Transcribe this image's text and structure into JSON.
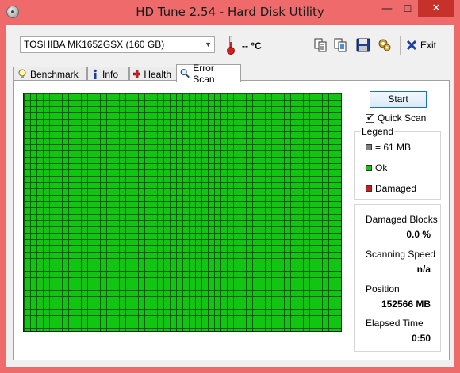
{
  "window": {
    "title": "HD Tune 2.54 - Hard Disk Utility",
    "minimize": "—",
    "maximize": "☐",
    "close": "✕"
  },
  "toolbar": {
    "drive": "TOSHIBA MK1652GSX (160 GB)",
    "temperature": "-- °C",
    "exit_label": "Exit",
    "icons": [
      "copy-text-icon",
      "copy-screenshot-icon",
      "save-icon",
      "options-icon",
      "exit-icon"
    ]
  },
  "tabs": [
    {
      "label": "Benchmark",
      "icon": "lightbulb-icon",
      "active": false
    },
    {
      "label": "Info",
      "icon": "info-icon",
      "active": false
    },
    {
      "label": "Health",
      "icon": "health-cross-icon",
      "active": false
    },
    {
      "label": "Error Scan",
      "icon": "magnifier-icon",
      "active": true
    }
  ],
  "error_scan": {
    "start_label": "Start",
    "quick_scan_label": "Quick Scan",
    "quick_scan_checked": true,
    "grid": {
      "columns": 50,
      "rows": 37,
      "block_color": "#11c611"
    },
    "legend": {
      "title": "Legend",
      "items": [
        {
          "label": "= 61 MB",
          "color": "#808080"
        },
        {
          "label": "Ok",
          "color": "#18c018"
        },
        {
          "label": "Damaged",
          "color": "#c81e1e"
        }
      ]
    },
    "stats": {
      "damaged_blocks_label": "Damaged Blocks",
      "damaged_blocks_value": "0.0 %",
      "scanning_speed_label": "Scanning Speed",
      "scanning_speed_value": "n/a",
      "position_label": "Position",
      "position_value": "152566 MB",
      "elapsed_label": "Elapsed Time",
      "elapsed_value": "0:50"
    }
  },
  "colors": {
    "frame": "#ef6b6b",
    "close_button": "#c7312b",
    "ok_green": "#11c611",
    "grid_line": "#0b5a0b"
  }
}
